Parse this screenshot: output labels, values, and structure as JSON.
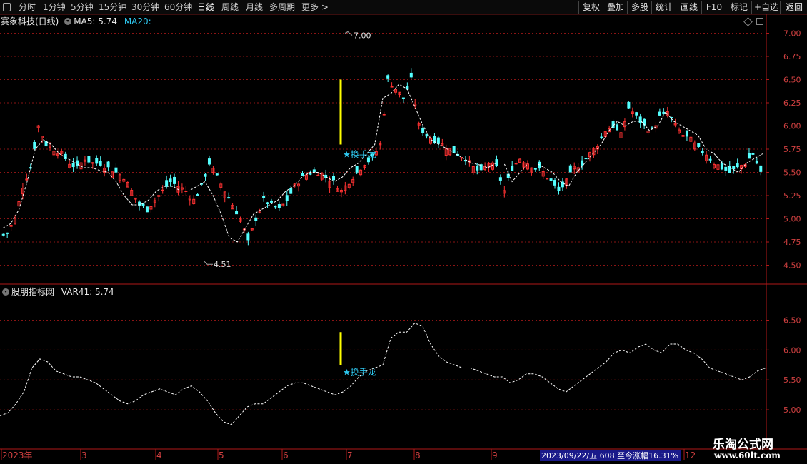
{
  "toolbar": {
    "periods": [
      "分时",
      "1分钟",
      "5分钟",
      "15分钟",
      "30分钟",
      "60分钟",
      "日线",
      "周线",
      "月线",
      "多周期",
      "更多"
    ],
    "active_period": "日线",
    "buttons": [
      "复权",
      "叠加",
      "多股",
      "统计",
      "画线",
      "F10",
      "标记",
      "+自选",
      "返回"
    ]
  },
  "main_panel": {
    "stock_name": "赛象科技(日线)",
    "ma5_label": "MA5: 5.74",
    "ma20_label": "MA20:",
    "y_ticks": [
      "7.00",
      "6.75",
      "6.50",
      "6.25",
      "6.00",
      "5.75",
      "5.50",
      "5.25",
      "5.00",
      "4.75",
      "4.50"
    ],
    "high_label": "7.00",
    "low_label": "4.51",
    "signal_label": "★换手龙"
  },
  "sub_panel": {
    "indicator_name": "股朋指标网",
    "var_label": "VAR41: 5.74",
    "y_ticks": [
      "6.50",
      "6.00",
      "5.50",
      "5.00"
    ],
    "signal_label": "★换手龙"
  },
  "time_axis": {
    "labels": [
      "2023年",
      "3",
      "4",
      "5",
      "6",
      "7",
      "8",
      "9",
      "12"
    ]
  },
  "status": {
    "text": "2023/09/22/五 608 至今涨幅16.31%"
  },
  "watermark": {
    "title": "乐淘公式网",
    "url": "www.60lt.com"
  },
  "colors": {
    "up": "#ff3232",
    "down": "#54ffff",
    "grid": "#8a1414",
    "signal": "#ffff00",
    "ma_line": "#ffffff",
    "label_cyan": "#2ec8f0"
  },
  "chart_data": {
    "type": "candlestick",
    "price_range": [
      4.45,
      7.05
    ],
    "sub_range": [
      4.75,
      6.9
    ],
    "price_closes": [
      4.85,
      5.0,
      5.35,
      5.55,
      6.0,
      5.8,
      5.75,
      5.7,
      5.6,
      5.55,
      5.65,
      5.6,
      5.6,
      5.55,
      5.5,
      5.45,
      5.3,
      5.15,
      5.1,
      5.2,
      5.3,
      5.4,
      5.35,
      5.3,
      5.2,
      5.35,
      5.6,
      5.45,
      5.3,
      5.15,
      5.0,
      4.75,
      5.0,
      5.2,
      5.15,
      5.1,
      5.2,
      5.35,
      5.45,
      5.5,
      5.5,
      5.45,
      5.4,
      5.3,
      5.4,
      5.5,
      5.6,
      5.65,
      5.8,
      6.5,
      6.4,
      6.3,
      6.5,
      6.0,
      5.9,
      5.85,
      5.8,
      5.75,
      5.7,
      5.65,
      5.55,
      5.5,
      5.6,
      5.55,
      5.3,
      5.55,
      5.65,
      5.6,
      5.55,
      5.5,
      5.4,
      5.3,
      5.4,
      5.55,
      5.6,
      5.7,
      5.8,
      5.95,
      6.0,
      5.9,
      6.2,
      6.1,
      6.0,
      5.95,
      6.1,
      6.15,
      6.0,
      5.9,
      5.85,
      5.75,
      5.7,
      5.6,
      5.55,
      5.5,
      5.55,
      5.6,
      5.7,
      5.5
    ],
    "ma20_values": [
      4.9,
      4.95,
      5.1,
      5.4,
      5.75,
      5.85,
      5.8,
      5.7,
      5.65,
      5.6,
      5.55,
      5.55,
      5.52,
      5.5,
      5.4,
      5.25,
      5.15,
      5.15,
      5.2,
      5.3,
      5.35,
      5.35,
      5.3,
      5.3,
      5.35,
      5.4,
      5.25,
      5.05,
      4.8,
      4.75,
      4.9,
      5.05,
      5.1,
      5.15,
      5.2,
      5.3,
      5.35,
      5.45,
      5.5,
      5.5,
      5.45,
      5.4,
      5.45,
      5.55,
      5.6,
      5.7,
      5.8,
      6.3,
      6.35,
      6.45,
      6.4,
      6.2,
      6.0,
      5.85,
      5.8,
      5.75,
      5.7,
      5.65,
      5.6,
      5.58,
      5.55,
      5.6,
      5.6,
      5.4,
      5.5,
      5.6,
      5.6,
      5.55,
      5.5,
      5.4,
      5.35,
      5.5,
      5.6,
      5.7,
      5.8,
      5.95,
      6.05,
      6.0,
      6.05,
      6.05,
      5.95,
      6.0,
      6.15,
      6.05,
      6.0,
      5.95,
      5.9,
      5.75,
      5.7,
      5.6,
      5.55,
      5.5,
      5.6,
      5.65,
      5.7
    ],
    "var41_values": [
      4.9,
      4.95,
      5.1,
      5.3,
      5.7,
      5.85,
      5.8,
      5.65,
      5.6,
      5.55,
      5.55,
      5.5,
      5.45,
      5.35,
      5.25,
      5.15,
      5.1,
      5.15,
      5.25,
      5.3,
      5.35,
      5.3,
      5.25,
      5.35,
      5.4,
      5.3,
      5.15,
      4.95,
      4.8,
      4.75,
      4.9,
      5.05,
      5.1,
      5.1,
      5.2,
      5.3,
      5.4,
      5.45,
      5.45,
      5.4,
      5.35,
      5.3,
      5.25,
      5.3,
      5.4,
      5.55,
      5.65,
      5.7,
      5.75,
      6.2,
      6.3,
      6.3,
      6.45,
      6.4,
      6.1,
      5.9,
      5.8,
      5.75,
      5.7,
      5.7,
      5.65,
      5.6,
      5.55,
      5.55,
      5.45,
      5.5,
      5.6,
      5.6,
      5.55,
      5.45,
      5.35,
      5.3,
      5.4,
      5.5,
      5.6,
      5.7,
      5.8,
      5.95,
      6.0,
      5.95,
      6.05,
      6.1,
      6.0,
      5.95,
      6.1,
      6.1,
      6.0,
      5.95,
      5.85,
      5.7,
      5.65,
      5.6,
      5.55,
      5.5,
      5.55,
      5.65,
      5.7
    ]
  }
}
